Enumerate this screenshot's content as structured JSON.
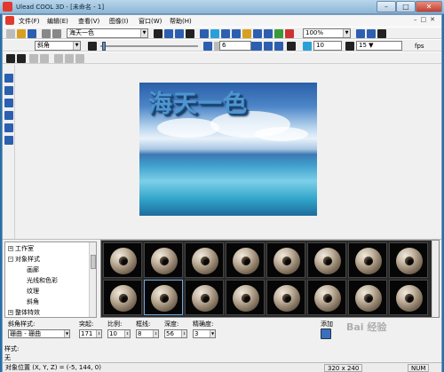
{
  "window": {
    "title": "Ulead COOL 3D - [未命名 - 1]"
  },
  "menu": [
    "文件(F)",
    "编辑(E)",
    "查看(V)",
    "图像(I)",
    "窗口(W)",
    "帮助(H)"
  ],
  "toolbar": {
    "text_combo": "海天一色",
    "zoom_combo": "100%",
    "bevel_combo": "斜角",
    "spin_a": "6",
    "spin_b": "10",
    "spin_c": "15",
    "fps_label": "fps"
  },
  "scene": {
    "text": "海天一色"
  },
  "tree": {
    "items": [
      {
        "label": "工作室",
        "level": 0,
        "expander": "+"
      },
      {
        "label": "对象样式",
        "level": 0,
        "expander": "−"
      },
      {
        "label": "画廊",
        "level": 1
      },
      {
        "label": "光线和色彩",
        "level": 1
      },
      {
        "label": "纹理",
        "level": 1
      },
      {
        "label": "斜角",
        "level": 1
      },
      {
        "label": "整体特效",
        "level": 0,
        "expander": "+"
      }
    ]
  },
  "params": {
    "bevel_style_label": "斜角样式:",
    "bevel_style_value": "珊曲 - 珊曲",
    "protrude_label": "突起:",
    "protrude_value": "171",
    "ratio_label": "比例:",
    "ratio_value": "10",
    "border_label": "框线:",
    "border_value": "8",
    "depth_label": "深度:",
    "depth_value": "56",
    "precision_label": "精确度:",
    "precision_value": "3",
    "add_label": "添加"
  },
  "style": {
    "label": "样式:",
    "value": "无"
  },
  "status": {
    "position": "对象位置 (X, Y, Z) = (-5, 144, 0)",
    "size": "320 x 240",
    "num": "NUM"
  },
  "watermark": "Bai 经验",
  "colors": {
    "accent": "#2d5fb0",
    "title_bar": "#8db6d6"
  }
}
